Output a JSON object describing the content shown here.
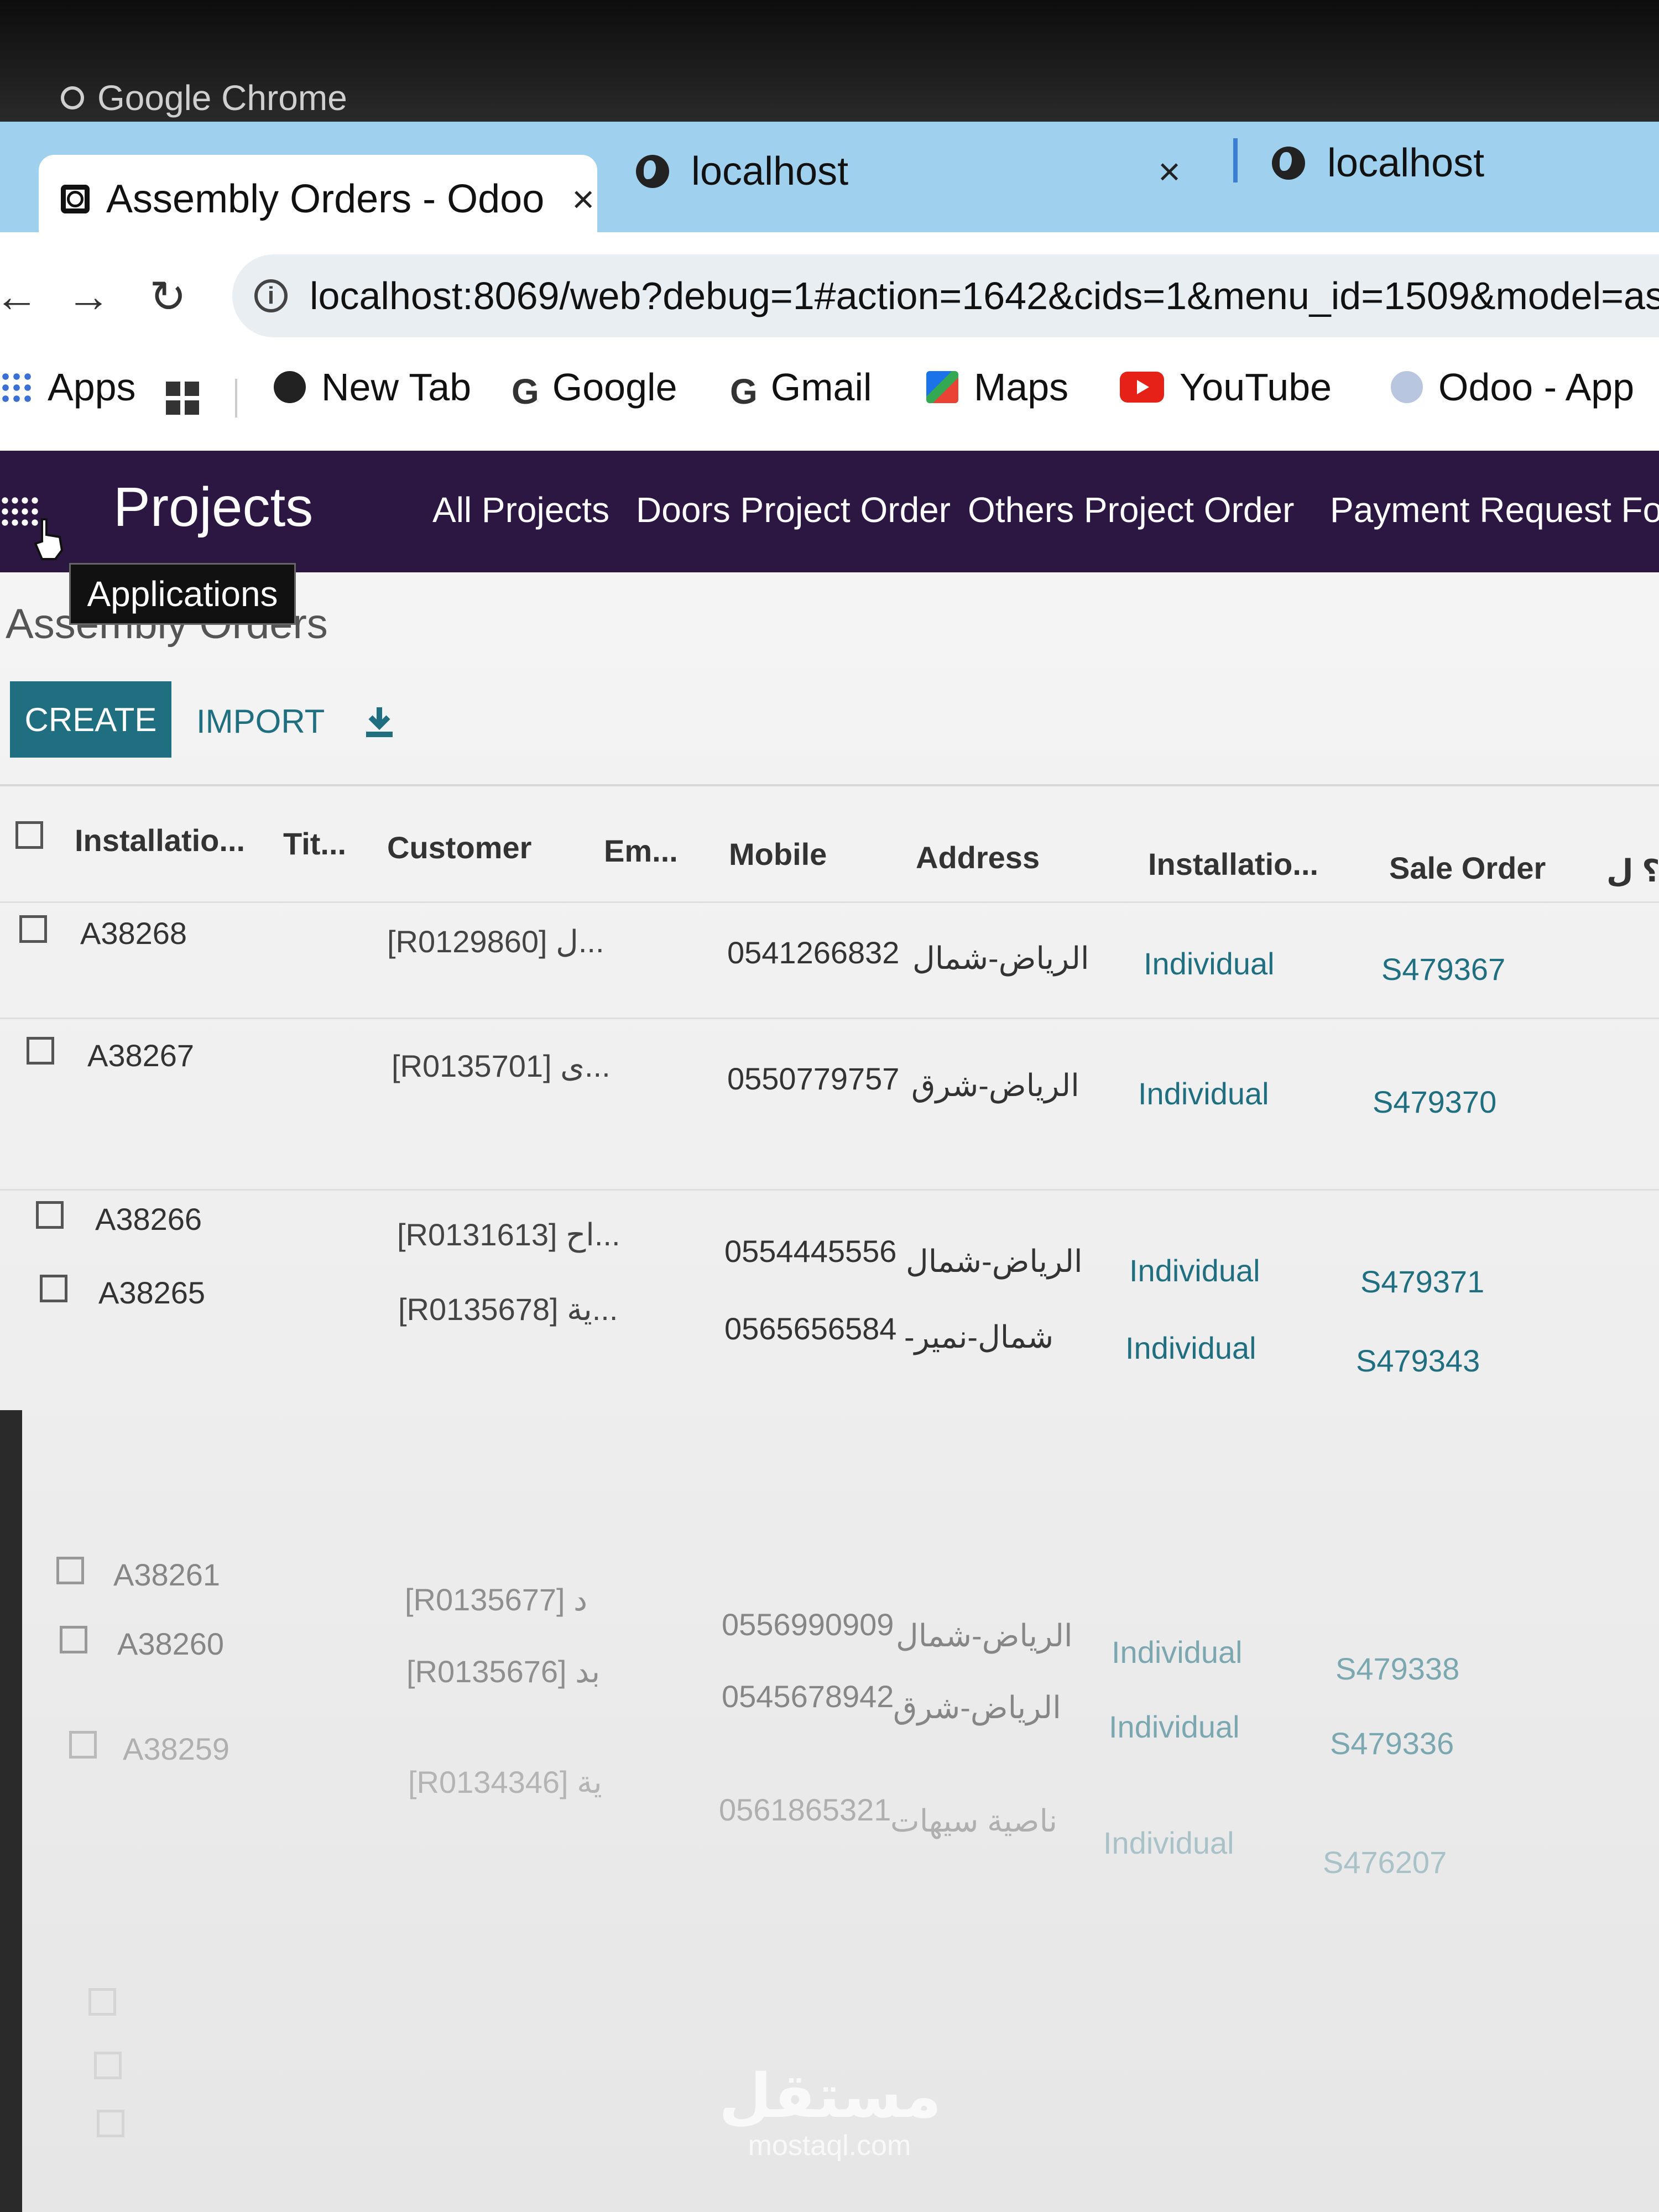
{
  "chrome": {
    "label": "Google Chrome",
    "tabs": [
      {
        "title": "Assembly Orders - Odoo",
        "icon": "odoo-favicon"
      },
      {
        "title": "localhost",
        "icon": "globe-icon"
      },
      {
        "title": "localhost",
        "icon": "globe-icon"
      }
    ],
    "close_symbol": "×",
    "url": "localhost:8069/web?debug=1#action=1642&cids=1&menu_id=1509&model=asse",
    "bookmarks": [
      {
        "label": "Apps",
        "icon": "apps-grid-icon"
      },
      {
        "label": "New Tab",
        "icon": "globe-icon"
      },
      {
        "label": "Google",
        "icon": "google-icon"
      },
      {
        "label": "Gmail",
        "icon": "google-icon"
      },
      {
        "label": "Maps",
        "icon": "maps-icon"
      },
      {
        "label": "YouTube",
        "icon": "youtube-icon"
      },
      {
        "label": "Odoo - App",
        "icon": "odoo-icon"
      }
    ]
  },
  "app": {
    "title": "Projects",
    "menu": [
      "All Projects",
      "Doors Project Order",
      "Others Project Order",
      "Payment Request Fo"
    ],
    "tooltip": "Applications",
    "accent": "#2b1742"
  },
  "page": {
    "breadcrumb": "Assembly Orders",
    "create_label": "CREATE",
    "import_label": "IMPORT",
    "button_color": "#1f6f80"
  },
  "table": {
    "headers": [
      "Installatio...",
      "Tit...",
      "Customer",
      "Em...",
      "Mobile",
      "Address",
      "Installatio...",
      "Sale Order",
      "؟ ل"
    ],
    "rows": [
      {
        "id": "A38268",
        "customer": "[R0129860] ل...",
        "mobile": "0541266832",
        "address": "الرياض-شمال",
        "type": "Individual",
        "sale_order": "S479367"
      },
      {
        "id": "A38267",
        "customer": "[R0135701] ى...",
        "mobile": "0550779757",
        "address": "الرياض-شرق",
        "type": "Individual",
        "sale_order": "S479370"
      },
      {
        "id": "A38266",
        "customer": "[R0131613] اح...",
        "mobile": "0554445556",
        "address": "الرياض-شمال",
        "type": "Individual",
        "sale_order": "S479371"
      },
      {
        "id": "A38265",
        "customer": "[R0135678] ية...",
        "mobile": "0565656584",
        "address": "-شمال-نمير",
        "type": "Individual",
        "sale_order": "S479343"
      },
      {
        "id": "A38261",
        "customer": "[R0135677] د",
        "mobile": "0556990909",
        "address": "الرياض-شمال",
        "type": "Individual",
        "sale_order": "S479338"
      },
      {
        "id": "A38260",
        "customer": "[R0135676] بد",
        "mobile": "0545678942",
        "address": "الرياض-شرق",
        "type": "Individual",
        "sale_order": "S479336"
      },
      {
        "id": "A38259",
        "customer": "[R0134346] ية",
        "mobile": "0561865321",
        "address": "ناصية سيهات",
        "type": "Individual",
        "sale_order": "S476207"
      }
    ]
  },
  "watermark": {
    "logo": "مستقل",
    "text": "mostaql.com"
  }
}
